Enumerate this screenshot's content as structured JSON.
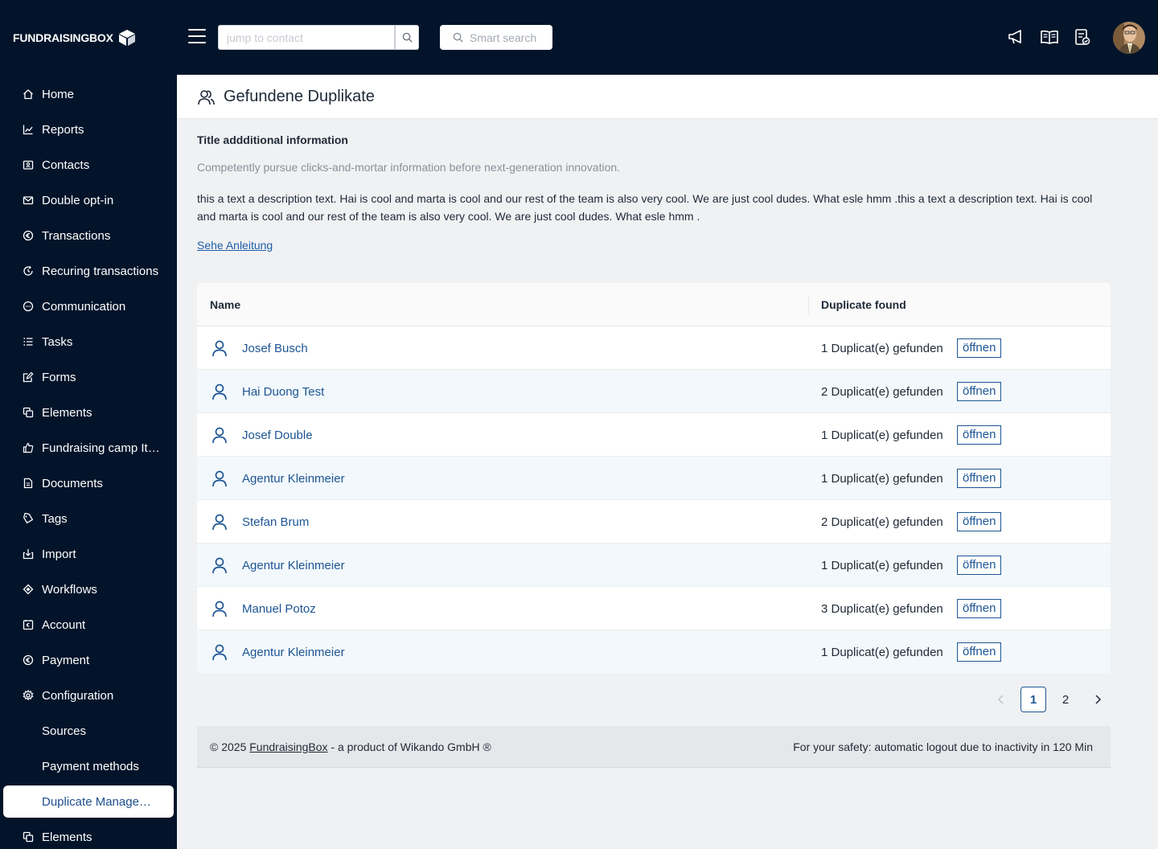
{
  "brand": {
    "name": "FUNDRAISINGBOX"
  },
  "topbar": {
    "jump_placeholder": "jump to contact",
    "smart_search_label": "Smart search",
    "icons": [
      "megaphone-icon",
      "book-icon",
      "checklist-icon"
    ]
  },
  "sidebar": {
    "items": [
      {
        "label": "Home",
        "icon": "home-icon"
      },
      {
        "label": "Reports",
        "icon": "chart-icon"
      },
      {
        "label": "Contacts",
        "icon": "contact-card-icon"
      },
      {
        "label": "Double opt-in",
        "icon": "mail-icon"
      },
      {
        "label": "Transactions",
        "icon": "euro-icon"
      },
      {
        "label": "Recuring transactions",
        "icon": "recurring-icon"
      },
      {
        "label": "Communication",
        "icon": "chat-icon"
      },
      {
        "label": "Tasks",
        "icon": "list-icon"
      },
      {
        "label": "Forms",
        "icon": "edit-icon"
      },
      {
        "label": "Elements",
        "icon": "copy-icon"
      },
      {
        "label": "Fundraising camp Item",
        "icon": "thumb-up-icon"
      },
      {
        "label": "Documents",
        "icon": "document-icon"
      },
      {
        "label": "Tags",
        "icon": "tag-icon"
      },
      {
        "label": "Import",
        "icon": "import-icon"
      },
      {
        "label": "Workflows",
        "icon": "workflow-icon"
      },
      {
        "label": "Account",
        "icon": "account-icon"
      },
      {
        "label": "Payment",
        "icon": "euro-icon"
      },
      {
        "label": "Configuration",
        "icon": "gear-icon"
      },
      {
        "label": "Sources",
        "icon": ""
      },
      {
        "label": "Payment methods",
        "icon": ""
      },
      {
        "label": "Duplicate Management",
        "icon": "",
        "active": true
      },
      {
        "label": "Elements",
        "icon": "copy-icon"
      }
    ]
  },
  "page": {
    "title": "Gefundene Duplikate",
    "info_title": "Title addditional information",
    "info_subtitle": "Competently pursue clicks-and-mortar information before next-generation innovation.",
    "description": "this a text a description text. Hai is cool and marta is cool and our rest of the team is also very cool. We are just cool dudes. What esle hmm .this a text a description text. Hai is cool and marta is cool and our rest of the team is also very cool. We are just cool dudes. What esle hmm .",
    "guide_link": "Sehe Anleitung"
  },
  "table": {
    "columns": [
      "Name",
      "Duplicate found"
    ],
    "open_label": "öffnen",
    "rows": [
      {
        "name": "Josef Busch",
        "found": "1 Duplicat(e) gefunden"
      },
      {
        "name": "Hai Duong Test",
        "found": "2 Duplicat(e) gefunden"
      },
      {
        "name": "Josef Double",
        "found": "1 Duplicat(e) gefunden"
      },
      {
        "name": "Agentur Kleinmeier",
        "found": "1 Duplicat(e) gefunden"
      },
      {
        "name": "Stefan Brum",
        "found": "2 Duplicat(e) gefunden"
      },
      {
        "name": "Agentur Kleinmeier",
        "found": "1 Duplicat(e) gefunden"
      },
      {
        "name": "Manuel Potoz",
        "found": "3 Duplicat(e) gefunden"
      },
      {
        "name": "Agentur Kleinmeier",
        "found": "1 Duplicat(e) gefunden"
      }
    ]
  },
  "pagination": {
    "pages": [
      "1",
      "2"
    ],
    "current": "1"
  },
  "footer": {
    "copyright_prefix": "© 2025 ",
    "copyright_link": "FundraisingBox",
    "copyright_suffix": " - a product of Wikando GmbH ®",
    "safety": "For your safety: automatic logout due to inactivity in 120 Min"
  },
  "colors": {
    "navy": "#03142a",
    "accent": "#1d5594",
    "row_alt": "#f2f8fb"
  }
}
